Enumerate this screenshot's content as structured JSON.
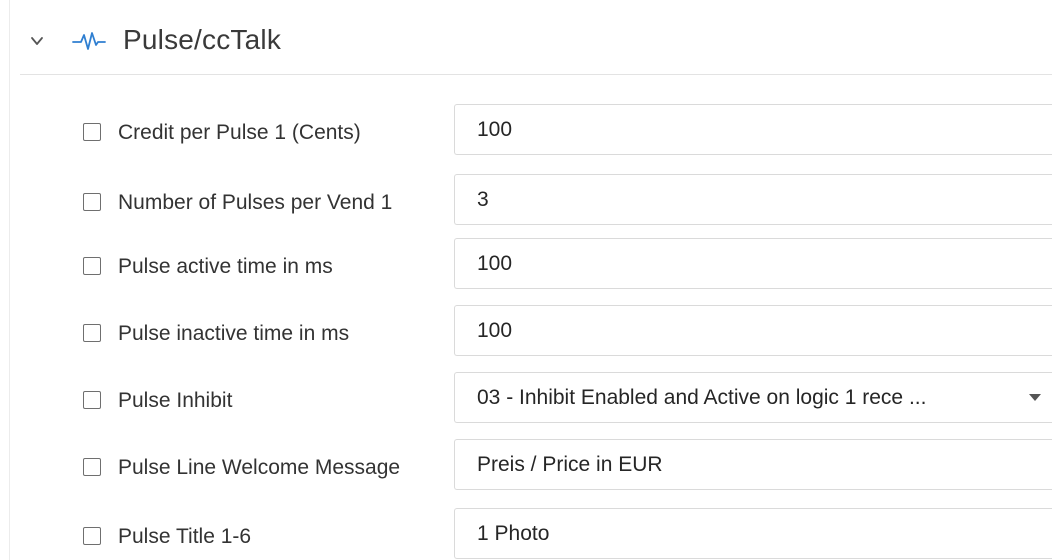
{
  "section": {
    "title": "Pulse/ccTalk",
    "icon": "pulse-wave-icon",
    "expander_icon": "chevron-down-icon"
  },
  "settings": [
    {
      "label": "Credit per Pulse 1 (Cents)",
      "value": "100",
      "checked": false,
      "control": "text"
    },
    {
      "label": "Number of Pulses per Vend 1",
      "value": "3",
      "checked": false,
      "control": "text"
    },
    {
      "label": "Pulse active time in ms",
      "value": "100",
      "checked": false,
      "control": "text"
    },
    {
      "label": "Pulse inactive time in ms",
      "value": "100",
      "checked": false,
      "control": "text"
    },
    {
      "label": "Pulse Inhibit",
      "value": "03 - Inhibit Enabled and Active on logic 1 rece ...",
      "checked": false,
      "control": "select"
    },
    {
      "label": "Pulse Line Welcome Message",
      "value": "Preis / Price in EUR",
      "checked": false,
      "control": "text"
    },
    {
      "label": "Pulse Title 1-6",
      "value": "1 Photo",
      "checked": false,
      "control": "text"
    }
  ],
  "colors": {
    "accent_icon": "#2f7fd1",
    "border": "#dadada",
    "text": "#333333"
  }
}
